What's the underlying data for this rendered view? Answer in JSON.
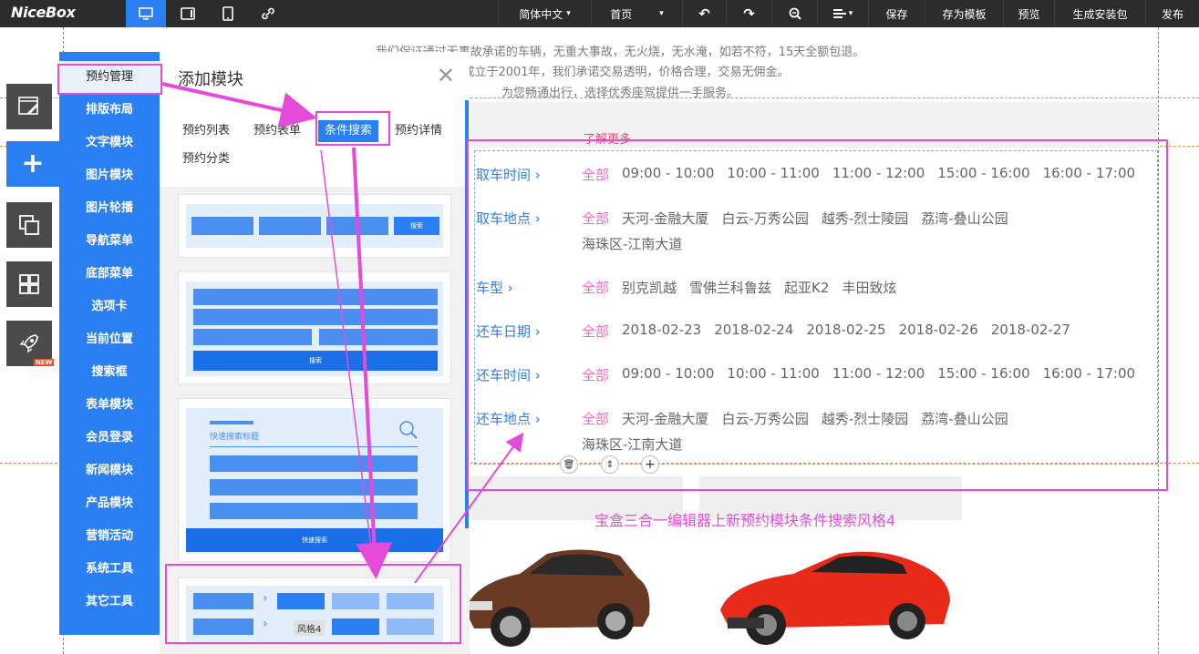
{
  "topbar": {
    "logo": "NiceBox",
    "lang": "简体中文",
    "page": "首页",
    "save": "保存",
    "save_template": "存为模板",
    "preview": "预览",
    "generate_pkg": "生成安装包",
    "publish": "发布"
  },
  "canvas": {
    "intro_lines": [
      "我们保证通过无事故承诺的车辆，无重大事故，无火烧，无水淹，如若不符，15天全额包退。",
      "司成立于2001年，我们承诺交易透明，价格合理，交易无佣金。",
      "为您畅通出行，选择优秀座驾提供一手服务。"
    ],
    "more_link": "了解更多",
    "caption": "宝盒三合一编辑器上新预约模块条件搜索风格4"
  },
  "filters": [
    {
      "label": "取车时间",
      "all": "全部",
      "options": [
        "09:00 - 10:00",
        "10:00 - 11:00",
        "11:00 - 12:00",
        "15:00 - 16:00",
        "16:00 - 17:00"
      ]
    },
    {
      "label": "取车地点",
      "all": "全部",
      "options": [
        "天河-金融大厦",
        "白云-万秀公园",
        "越秀-烈士陵园",
        "荔湾-叠山公园"
      ],
      "options2": [
        "海珠区-江南大道"
      ]
    },
    {
      "label": "车型",
      "all": "全部",
      "options": [
        "别克凯越",
        "雪佛兰科鲁兹",
        "起亚K2",
        "丰田致炫"
      ]
    },
    {
      "label": "还车日期",
      "all": "全部",
      "options": [
        "2018-02-23",
        "2018-02-24",
        "2018-02-25",
        "2018-02-26",
        "2018-02-27"
      ]
    },
    {
      "label": "还车时间",
      "all": "全部",
      "options": [
        "09:00 - 10:00",
        "10:00 - 11:00",
        "11:00 - 12:00",
        "15:00 - 16:00",
        "16:00 - 17:00"
      ]
    },
    {
      "label": "还车地点",
      "all": "全部",
      "options": [
        "天河-金融大厦",
        "白云-万秀公园",
        "越秀-烈士陵园",
        "荔湾-叠山公园"
      ],
      "options2": [
        "海珠区-江南大道"
      ]
    }
  ],
  "categories": [
    "预约管理",
    "排版布局",
    "文字模块",
    "图片模块",
    "图片轮播",
    "导航菜单",
    "底部菜单",
    "选项卡",
    "当前位置",
    "搜索框",
    "表单模块",
    "会员登录",
    "新闻模块",
    "产品模块",
    "营销活动",
    "系统工具",
    "其它工具"
  ],
  "panel": {
    "title": "添加模块",
    "tabs": [
      "预约列表",
      "预约表单",
      "条件搜索",
      "预约详情",
      "预约分类"
    ],
    "card1_btn": "搜索",
    "card2_btn": "搜索",
    "card3_title": "快速搜索标题",
    "card3_btn": "快速搜索",
    "card4_tooltip": "风格4"
  },
  "leftbar": {
    "new_badge": "NEW"
  },
  "colors": {
    "accent": "#2a7ff2",
    "highlight": "#e64ad9",
    "all_pink": "#f36cba"
  }
}
